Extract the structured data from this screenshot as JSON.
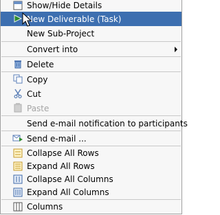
{
  "menu": {
    "items": [
      {
        "label": "Show/Hide Details",
        "icon": "panel-toggle-icon",
        "state": "normal"
      },
      {
        "label": "New Deliverable (Task)",
        "icon": "new-deliverable-icon",
        "state": "highlighted"
      },
      {
        "label": "New Sub-Project",
        "icon": "",
        "state": "normal"
      },
      {
        "label": "Convert into",
        "icon": "",
        "state": "normal",
        "submenu": true
      },
      {
        "label": "Delete",
        "icon": "trash-icon",
        "state": "normal"
      },
      {
        "label": "Copy",
        "icon": "copy-icon",
        "state": "normal"
      },
      {
        "label": "Cut",
        "icon": "scissors-icon",
        "state": "normal"
      },
      {
        "label": "Paste",
        "icon": "paste-icon",
        "state": "disabled"
      },
      {
        "label": "Send e-mail notification to participants",
        "icon": "",
        "state": "normal"
      },
      {
        "label": "Send e-mail ...",
        "icon": "email-send-icon",
        "state": "normal"
      },
      {
        "label": "Collapse All Rows",
        "icon": "collapse-rows-icon",
        "state": "normal"
      },
      {
        "label": "Expand All Rows",
        "icon": "expand-rows-icon",
        "state": "normal"
      },
      {
        "label": "Collapse All Columns",
        "icon": "collapse-columns-icon",
        "state": "normal"
      },
      {
        "label": "Expand All Columns",
        "icon": "expand-columns-icon",
        "state": "normal"
      },
      {
        "label": "Columns",
        "icon": "columns-icon",
        "state": "normal"
      }
    ]
  },
  "colors": {
    "highlight": "#3d6fb0",
    "disabled_text": "#a5a5a5",
    "menu_background": "#f7f7f7"
  }
}
